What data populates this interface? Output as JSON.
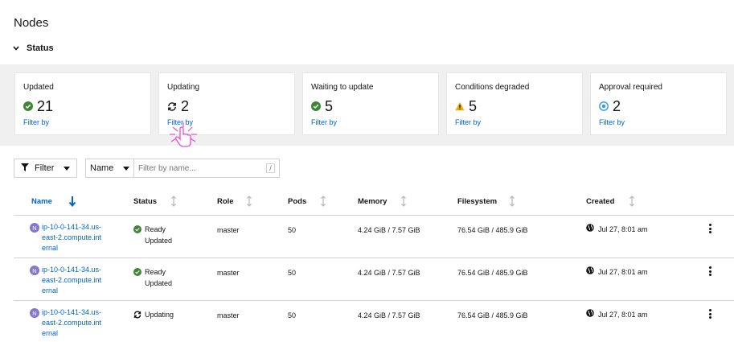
{
  "page": {
    "title": "Nodes"
  },
  "status_section": {
    "toggle_label": "Status"
  },
  "status_cards": [
    {
      "title": "Updated",
      "count": "21",
      "icon": "check-circle-icon",
      "filter_label": "Filter by"
    },
    {
      "title": "Updating",
      "count": "2",
      "icon": "sync-icon",
      "filter_label": "Filter by"
    },
    {
      "title": "Waiting to update",
      "count": "5",
      "icon": "check-circle-icon",
      "filter_label": "Filter by"
    },
    {
      "title": "Conditions degraded",
      "count": "5",
      "icon": "warning-triangle-icon",
      "filter_label": "Filter by"
    },
    {
      "title": "Approval required",
      "count": "2",
      "icon": "plus-circle-icon",
      "filter_label": "Filter by"
    }
  ],
  "toolbar": {
    "filter_label": "Filter",
    "name_select": "Name",
    "search_placeholder": "Filter by name...",
    "search_shortcut": "/"
  },
  "table": {
    "columns": [
      "Name",
      "Status",
      "Role",
      "Pods",
      "Memory",
      "Filesystem",
      "Created"
    ],
    "rows": [
      {
        "badge": "N",
        "name": "ip-10-0-141-34.us-east-2.compute.internal",
        "status": [
          "Ready",
          "Updated"
        ],
        "status_icon": "check-circle-icon",
        "role": "master",
        "pods": "50",
        "memory": "4.24 GiB / 7.57 GiB",
        "filesystem": "76.54 GiB / 485.9 GiB",
        "created": "Jul 27, 8:01 am"
      },
      {
        "badge": "N",
        "name": "ip-10-0-141-34.us-east-2.compute.internal",
        "status": [
          "Ready",
          "Updated"
        ],
        "status_icon": "check-circle-icon",
        "role": "master",
        "pods": "50",
        "memory": "4.24 GiB / 7.57 GiB",
        "filesystem": "76.54 GiB / 485.9 GiB",
        "created": "Jul 27, 8:01 am"
      },
      {
        "badge": "N",
        "name": "ip-10-0-141-34.us-east-2.compute.internal",
        "status": [
          "Updating",
          ""
        ],
        "status_icon": "sync-icon",
        "role": "master",
        "pods": "50",
        "memory": "4.24 GiB / 7.57 GiB",
        "filesystem": "76.54 GiB / 485.9 GiB",
        "created": "Jul 27, 8:01 am"
      }
    ]
  },
  "colors": {
    "link": "#0066cc",
    "success": "#3e8635",
    "warning": "#f0ab00",
    "info": "#2b9af3",
    "band": "#f0f0f0",
    "node_badge": "#8476d1"
  }
}
